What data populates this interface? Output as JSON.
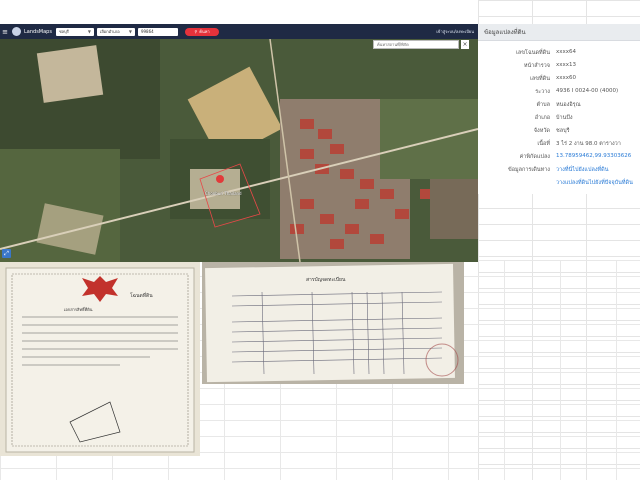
{
  "app": {
    "brand": "LandsMaps",
    "province_select": "ชลบุรี",
    "district_select": "เลือกอำเภอ",
    "parcel_input": "99864",
    "search_button": "ค้นหา",
    "user_link": "เข้าสู่ระบบ/ลงทะเบียน",
    "map_search_placeholder": "ค้นหาสถานที่/พิกัด",
    "place_label": "Chonburi Thailand",
    "map_close": "×"
  },
  "panel": {
    "title": "ข้อมูลแปลงที่ดิน",
    "rows": [
      {
        "key": "เลขโฉนดที่ดิน",
        "value": "xxxx64"
      },
      {
        "key": "หน้าสำรวจ",
        "value": "xxxx13"
      },
      {
        "key": "เลขที่ดิน",
        "value": "xxxx60"
      },
      {
        "key": "ระวาง",
        "value": "4936 I 0024-00 (4000)"
      },
      {
        "key": "ตำบล",
        "value": "หนองอิรุณ"
      },
      {
        "key": "อำเภอ",
        "value": "บ้านบึง"
      },
      {
        "key": "จังหวัด",
        "value": "ชลบุรี"
      },
      {
        "key": "เนื้อที่",
        "value": "3 ไร่ 2 งาน 98.0 ตารางวา"
      },
      {
        "key": "ค่าพิกัดแปลง",
        "value": "13.78959462,99.93303626"
      },
      {
        "key": "ข้อมูลการเดินทาง",
        "value": "วางที่นี่ไปยังแปลงที่ดิน"
      },
      {
        "key": "",
        "value": "วางแปลงที่ดินไปยังที่ปัจจุบันที่ดิน"
      }
    ]
  },
  "deed": {
    "header": "โฉนดที่ดิน",
    "subheader": "เอกสารสิทธิ์ที่ดิน",
    "register_title": "สารบัญจดทะเบียน"
  },
  "colors": {
    "topbar": "#1f2a44",
    "search_red": "#e5323b",
    "link_blue": "#2a7bd6"
  }
}
